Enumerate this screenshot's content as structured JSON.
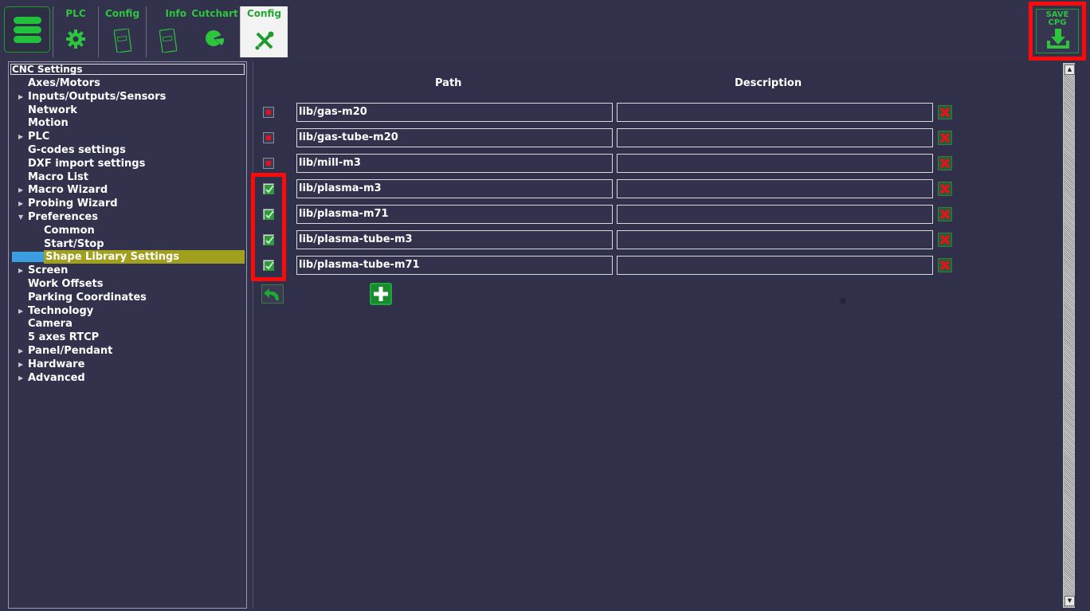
{
  "toolbar": {
    "tabs": [
      {
        "label": "PLC",
        "icon": "gear-icon"
      },
      {
        "label": "Config",
        "icon": "document-icon"
      },
      {
        "label": "Info",
        "icon": "document-icon"
      },
      {
        "label": "Cutchart",
        "icon": "pie-chart-icon"
      },
      {
        "label": "Config",
        "icon": "tools-icon",
        "active": true
      }
    ],
    "save": {
      "line1": "SAVE",
      "line2": "CPG",
      "icon": "download-icon"
    }
  },
  "tree": {
    "header": "CNC Settings",
    "items": [
      {
        "label": "Axes/Motors",
        "expandable": false
      },
      {
        "label": "Inputs/Outputs/Sensors",
        "expandable": true
      },
      {
        "label": "Network",
        "expandable": false
      },
      {
        "label": "Motion",
        "expandable": false
      },
      {
        "label": "PLC",
        "expandable": true
      },
      {
        "label": "G-codes settings",
        "expandable": false
      },
      {
        "label": "DXF import settings",
        "expandable": false
      },
      {
        "label": "Macro List",
        "expandable": false
      },
      {
        "label": "Macro Wizard",
        "expandable": true
      },
      {
        "label": "Probing Wizard",
        "expandable": true
      },
      {
        "label": "Preferences",
        "expandable": true,
        "expanded": true
      },
      {
        "label": "Common",
        "child": true
      },
      {
        "label": "Start/Stop",
        "child": true
      },
      {
        "label": "Shape Library Settings",
        "child": true,
        "selected": true
      },
      {
        "label": "Screen",
        "expandable": true
      },
      {
        "label": "Work Offsets",
        "expandable": false
      },
      {
        "label": "Parking Coordinates",
        "expandable": false
      },
      {
        "label": "Technology",
        "expandable": true
      },
      {
        "label": "Camera",
        "expandable": false
      },
      {
        "label": "5 axes RTCP",
        "expandable": false
      },
      {
        "label": "Panel/Pendant",
        "expandable": true
      },
      {
        "label": "Hardware",
        "expandable": true
      },
      {
        "label": "Advanced",
        "expandable": true
      }
    ]
  },
  "table": {
    "col_path": "Path",
    "col_description": "Description",
    "rows": [
      {
        "enabled": false,
        "path": "lib/gas-m20",
        "description": ""
      },
      {
        "enabled": false,
        "path": "lib/gas-tube-m20",
        "description": ""
      },
      {
        "enabled": false,
        "path": "lib/mill-m3",
        "description": ""
      },
      {
        "enabled": true,
        "path": "lib/plasma-m3",
        "description": ""
      },
      {
        "enabled": true,
        "path": "lib/plasma-m71",
        "description": ""
      },
      {
        "enabled": true,
        "path": "lib/plasma-tube-m3",
        "description": ""
      },
      {
        "enabled": true,
        "path": "lib/plasma-tube-m71",
        "description": ""
      }
    ]
  },
  "colors": {
    "background": "#32324c",
    "accent_green": "#2ec43e",
    "highlight_red": "#ff0a0a",
    "selection": "#a09f1e"
  }
}
